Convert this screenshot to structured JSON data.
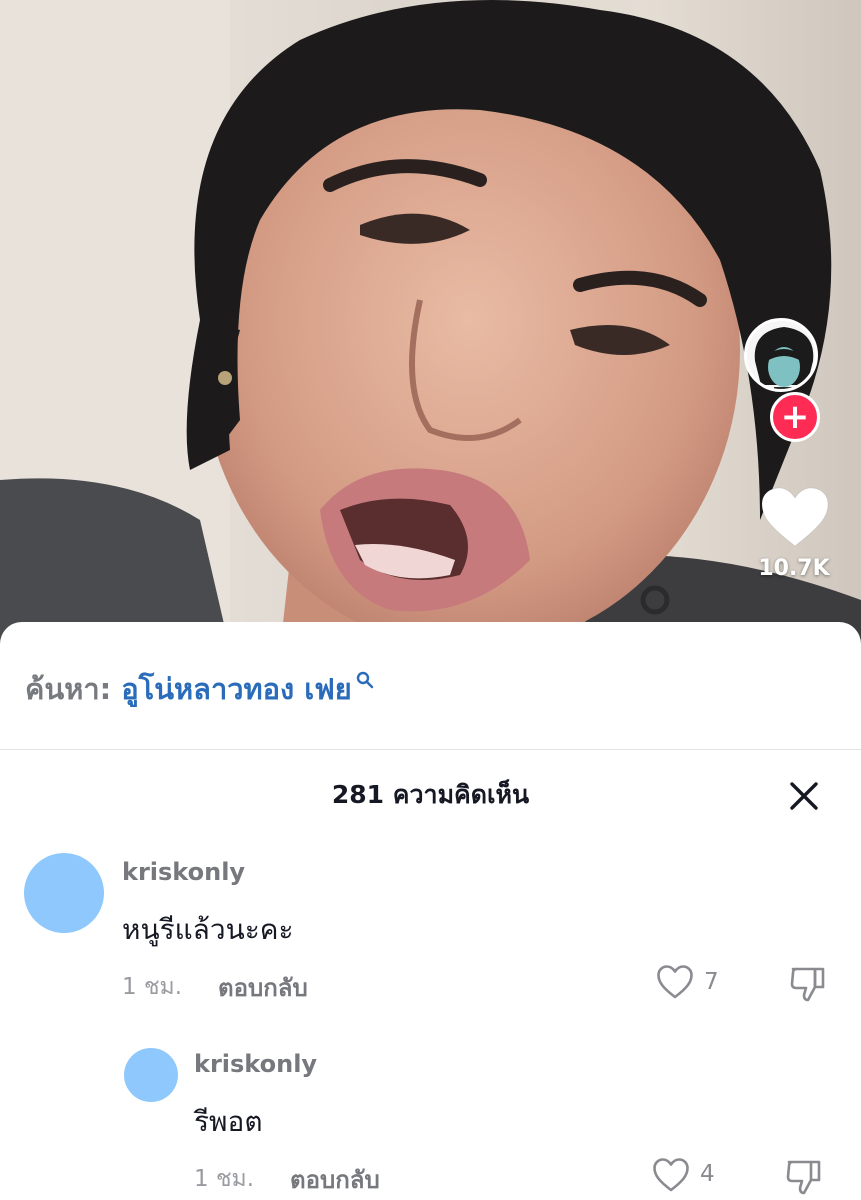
{
  "video": {
    "like_count": "10.7K",
    "follow_icon": "plus-icon"
  },
  "search": {
    "prefix": "ค้นหา:",
    "term": "อูโน่หลาวทอง เฟย"
  },
  "comments_panel": {
    "title": "281 ความคิดเห็น",
    "comments": [
      {
        "username": "kriskonly",
        "text": "หนูรีแล้วนะคะ",
        "time": "1 ชม.",
        "reply_label": "ตอบกลับ",
        "likes": "7"
      },
      {
        "username": "kriskonly",
        "text": "รีพอต",
        "time": "1 ชม.",
        "reply_label": "ตอบกลับ",
        "likes": "4"
      }
    ]
  },
  "colors": {
    "accent": "#fe2c55",
    "link": "#2a6cba",
    "avatar": "#8fc8fc"
  }
}
